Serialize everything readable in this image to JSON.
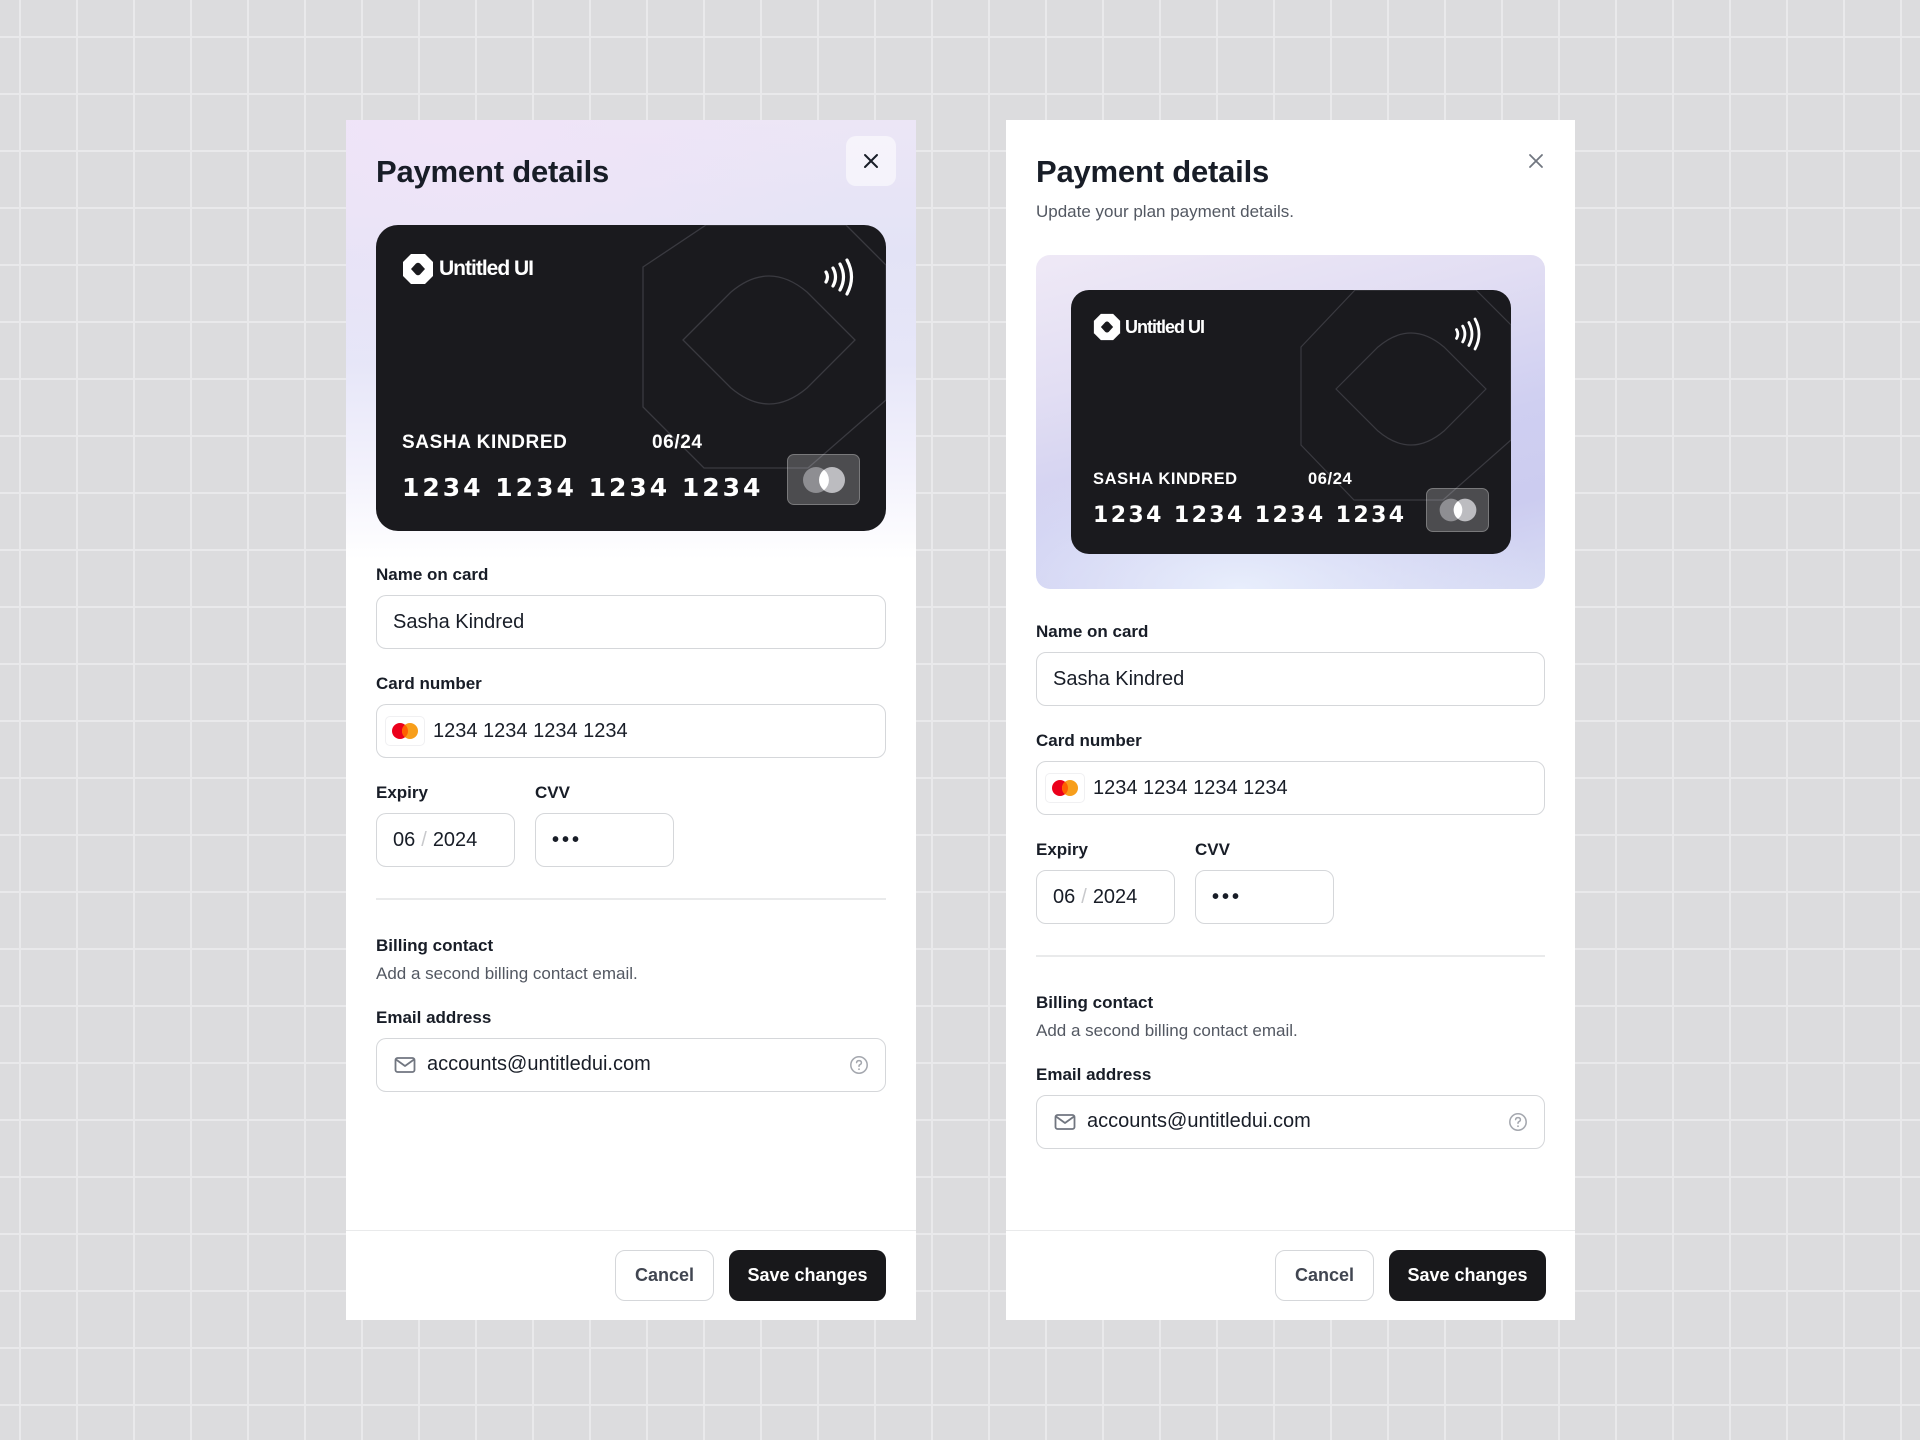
{
  "colors": {
    "primary_button": "#18181b",
    "card_background": "#1a1a1e",
    "mastercard_red": "#eb001b",
    "mastercard_orange": "#f79e1b"
  },
  "panels": [
    {
      "variant": "gradient-header",
      "title": "Payment details",
      "subtitle": null,
      "close_icon": "x-close-icon",
      "card": {
        "brand": "Untitled UI",
        "holder": "SASHA KINDRED",
        "expiry": "06/24",
        "number": "1234 1234 1234 1234",
        "network_icon": "mastercard-icon",
        "contactless_icon": "contactless-icon"
      },
      "form": {
        "name_label": "Name on card",
        "name_value": "Sasha Kindred",
        "number_label": "Card number",
        "number_value": "1234 1234 1234 1234",
        "expiry_label": "Expiry",
        "expiry_month": "06",
        "expiry_sep": "/",
        "expiry_year": "2024",
        "cvv_label": "CVV",
        "cvv_value": "•••"
      },
      "billing": {
        "title": "Billing contact",
        "description": "Add a second billing contact email.",
        "email_label": "Email address",
        "email_value": "accounts@untitledui.com",
        "email_icon": "mail-icon",
        "help_icon": "help-circle-icon"
      },
      "footer": {
        "cancel_label": "Cancel",
        "save_label": "Save changes"
      }
    },
    {
      "variant": "white-with-card-frame",
      "title": "Payment details",
      "subtitle": "Update your plan payment details.",
      "close_icon": "x-close-icon",
      "card": {
        "brand": "Untitled UI",
        "holder": "SASHA KINDRED",
        "expiry": "06/24",
        "number": "1234 1234 1234 1234",
        "network_icon": "mastercard-icon",
        "contactless_icon": "contactless-icon"
      },
      "form": {
        "name_label": "Name on card",
        "name_value": "Sasha Kindred",
        "number_label": "Card number",
        "number_value": "1234 1234 1234 1234",
        "expiry_label": "Expiry",
        "expiry_month": "06",
        "expiry_sep": "/",
        "expiry_year": "2024",
        "cvv_label": "CVV",
        "cvv_value": "•••"
      },
      "billing": {
        "title": "Billing contact",
        "description": "Add a second billing contact email.",
        "email_label": "Email address",
        "email_value": "accounts@untitledui.com",
        "email_icon": "mail-icon",
        "help_icon": "help-circle-icon"
      },
      "footer": {
        "cancel_label": "Cancel",
        "save_label": "Save changes"
      }
    }
  ]
}
